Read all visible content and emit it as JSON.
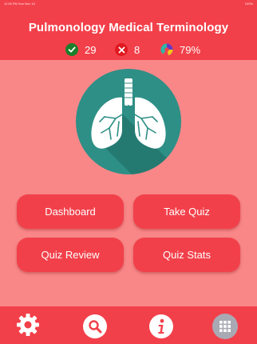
{
  "statusbar": {
    "time": "11:06 PM   Sun Nov 10",
    "battery": "100%"
  },
  "header": {
    "title": "Pulmonology Medical Terminology",
    "stats": {
      "correct": "29",
      "incorrect": "8",
      "score": "79%"
    }
  },
  "buttons": {
    "dashboard": "Dashboard",
    "take_quiz": "Take Quiz",
    "quiz_review": "Quiz Review",
    "quiz_stats": "Quiz Stats"
  },
  "icons": {
    "correct": "check-circle-icon",
    "incorrect": "x-circle-icon",
    "score": "pie-chart-icon",
    "hero": "lungs-icon",
    "tab1": "gear-icon",
    "tab2": "search-icon",
    "tab3": "info-icon",
    "tab4": "grid-icon"
  },
  "colors": {
    "primary": "#F2404A",
    "background": "#F98788",
    "badge": "#2E8F86",
    "correct": "#1b7f2a",
    "incorrect": "#e01820"
  }
}
